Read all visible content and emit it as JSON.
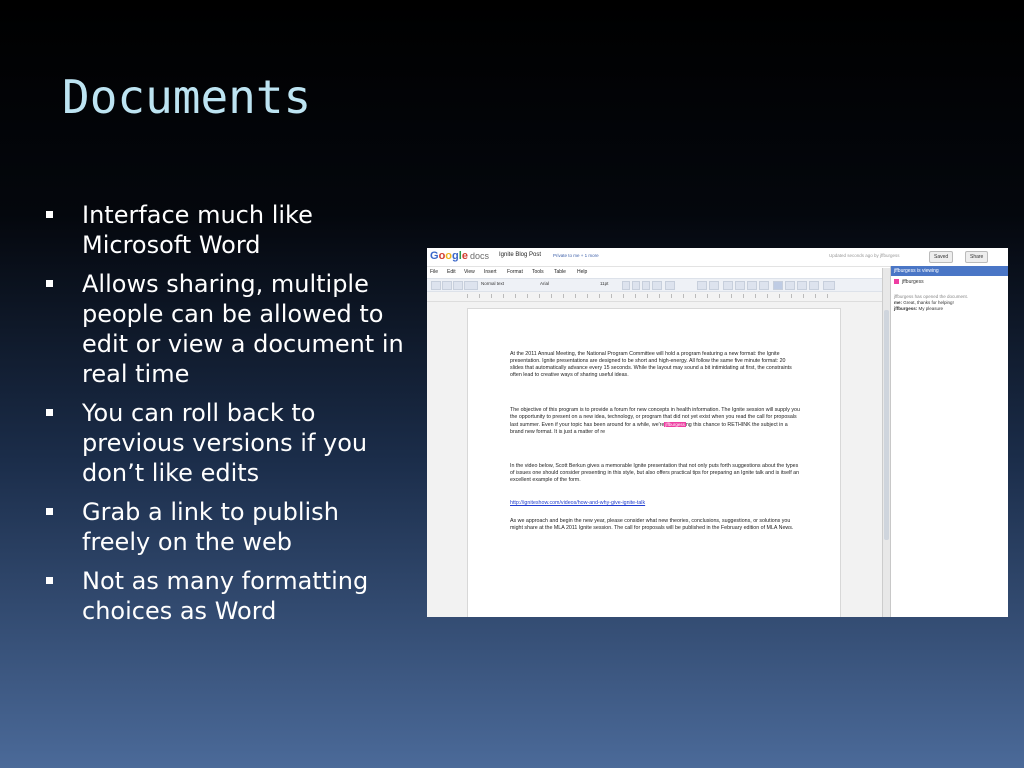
{
  "slide": {
    "title": "Documents",
    "bullets": [
      "Interface much like Microsoft Word",
      "Allows sharing, multiple people can be allowed to edit or view a document in real time",
      "You can roll back to previous versions if you don’t like edits",
      "Grab a link to publish freely on the web",
      "Not as many formatting choices as Word"
    ]
  },
  "screenshot": {
    "logo": "Google",
    "logo_suffix": "docs",
    "doc_title": "Ignite Blog Post",
    "privacy": "Private to me + 1 more",
    "updated": "Updated seconds ago by jffburgess",
    "saved_label": "Saved",
    "share_label": "Share",
    "menu": [
      "File",
      "Edit",
      "View",
      "Insert",
      "Format",
      "Tools",
      "Table",
      "Help"
    ],
    "toolbar": {
      "style": "Normal text",
      "font": "Arial",
      "size": "11pt"
    },
    "paragraphs": [
      "At the 2011 Annual Meeting, the National Program Committee will hold a program featuring a new format: the Ignite presentation. Ignite presentations are designed to be short and high-energy. All follow the same five minute format: 20 slides that automatically advance every 15 seconds. While the layout may sound a bit intimidating at first, the constraints often lead to creative ways of sharing useful ideas.",
      "The objective of this program is to provide a forum for new concepts in health information. The Ignite session will supply you the opportunity to present on a new idea, technology, or program that did not yet exist when you read the call for proposals last summer. Even if your topic has been around for a while, we're",
      "ng this chance to RETHINK the subject in a brand new format. It is just a matter of re",
      "In the video below, Scott Berkun gives a memorable Ignite presentation that not only puts forth suggestions about the types of issues one should consider presenting in this style, but also offers practical tips for preparing an Ignite talk and is itself an excellent example of the form.",
      "As we approach and begin the new year, please consider what new theories, conclusions, suggestions, or solutions you might share at the MLA 2011 Ignite session. The call for proposals will be published in the February edition of MLA News."
    ],
    "cursor_label": "jffburgess",
    "link": "http://igniteshow.com/videos/how-and-why-give-ignite-talk",
    "sidebar": {
      "header": "jffburgess is viewing",
      "user": "jffburgess",
      "event": "jffburgess has opened the document.",
      "chat1_speaker": "me:",
      "chat1_text": "Great, thanks for helping!",
      "chat2_speaker": "jffburgess:",
      "chat2_text": "My pleasure"
    },
    "colors": {
      "accent": "#4a76c6",
      "cursor": "#ee3ea2",
      "link": "#1f3ccf"
    }
  }
}
